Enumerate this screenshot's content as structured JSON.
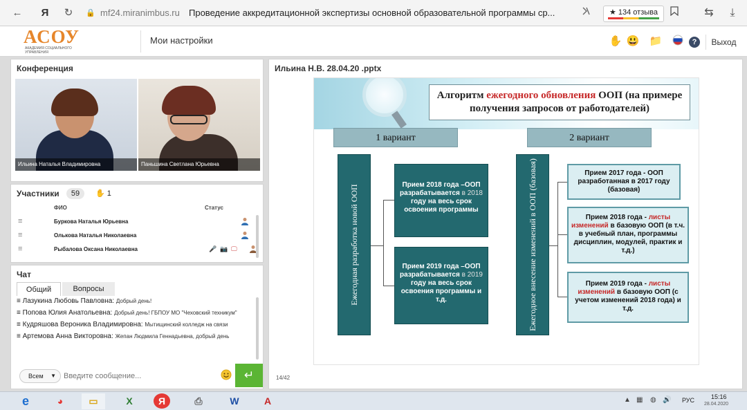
{
  "browser": {
    "back_icon": "←",
    "browser_logo": "Я",
    "reload_icon": "↻",
    "lock_icon": "🔒",
    "url_host": "mf24.miranimbus.ru",
    "tab_title": "Проведение аккредитационной экспертизы основной образовательной программы ср...",
    "reviews_label": "★ 134 отзыва",
    "translate_icon": "⇆",
    "download_icon": "⤓"
  },
  "header": {
    "logo_text": "АСОУ",
    "logo_subtitle": "АКАДЕМИЯ СОЦИАЛЬНОГО УПРАВЛЕНИЯ",
    "settings_label": "Мои настройки",
    "hand_icon": "✋",
    "emoji_icon": "😃",
    "folder_icon": "📁",
    "help_icon": "?",
    "exit_label": "Выход"
  },
  "conference": {
    "title": "Конференция",
    "videos": [
      {
        "name": "Ильина Наталья Владимировна"
      },
      {
        "name": "Паньшина Светлана Юрьевна"
      }
    ]
  },
  "participants": {
    "title": "Участники",
    "count": "59",
    "hand_icon": "✋",
    "hand_count": "1",
    "col_name": "ФИО",
    "col_status": "Статус",
    "rows": [
      {
        "name": "Буркова Наталья Юрьевна"
      },
      {
        "name": "Олькова Наталья Николаевна"
      },
      {
        "name": "Рыбалова Оксана Николаевна"
      }
    ]
  },
  "chat": {
    "title": "Чат",
    "tabs": [
      "Общий",
      "Вопросы"
    ],
    "messages": [
      {
        "author": "Лазукина Любовь Павловна:",
        "text": "Добрый день!"
      },
      {
        "author": "Попова Юлия Анатольевна:",
        "text": "Добрый день! ГБПОУ МО \"Чеховский техникум\""
      },
      {
        "author": "Кудряшова Вероника Владимировна:",
        "text": "Мытищинский колледж на связи"
      },
      {
        "author": "Артемова Анна Викторовна:",
        "text": "Жепан Людмила Геннадьевна, добрый день"
      }
    ],
    "recipient": "Всем",
    "input_placeholder": "Введите сообщение...",
    "send_icon": "↵"
  },
  "presentation": {
    "file_name": "Ильина Н.В. 28.04.20 .pptx",
    "page": "14/42",
    "slide": {
      "title_a": "Алгоритм ",
      "title_b": "ежегодного обновления",
      "title_c": " ООП (на примере получения запросов от работодателей)",
      "variant1": "1 вариант",
      "variant2": "2 вариант",
      "vertical1": "Ежегодная разработка новой ООП",
      "vertical2": "Ежегодное внесение изменений в ООП (базовая)",
      "v1_box1": {
        "a": "Прием 2018 года –ООП разрабатывается",
        "b": " в 2018 ",
        "c": "году на весь срок освоения программы"
      },
      "v1_box2": {
        "a": "Прием 2019 года –ООП разрабатывается",
        "b": " в 2019 ",
        "c": "году на весь срок освоения программы и т.д."
      },
      "v2_box1": "Прием 2017 года - ООП разработанная в 2017 году (базовая)",
      "v2_box2": {
        "a": "Прием 2018 года - ",
        "b": "листы изменений",
        "c": " в базовую ООП (в т.ч. в учебный план, программы дисциплин, модулей, практик и т.д.)"
      },
      "v2_box3": {
        "a": "Прием 2019 года - ",
        "b": "листы изменений",
        "c": " в базовую ООП (с учетом изменений 2018 года) и т.д."
      }
    }
  },
  "taskbar": {
    "apps": [
      "e",
      "◕",
      "▭",
      "X",
      "Я",
      "⎙",
      "W",
      "A"
    ],
    "lang": "РУС",
    "time": "15:16",
    "date": "28.04.2020"
  }
}
